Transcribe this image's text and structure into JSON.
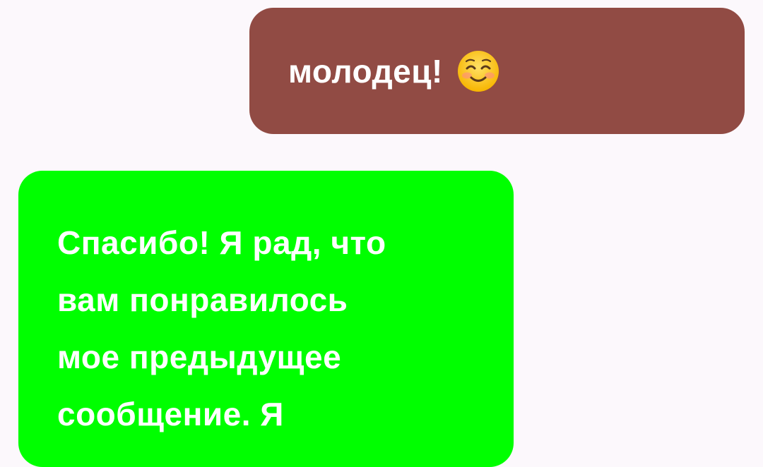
{
  "colors": {
    "background": "#fcf8fc",
    "outgoing_bubble": "#914b44",
    "incoming_bubble": "#00ff00",
    "text": "#ffffff"
  },
  "messages": [
    {
      "direction": "outgoing",
      "text": "молодец!",
      "emoji": "smiling-face-with-smiling-eyes-icon"
    },
    {
      "direction": "incoming",
      "text": "Спасибо! Я рад, что\nвам понравилось\nмое предыдущее\nсообщение. Я"
    }
  ]
}
